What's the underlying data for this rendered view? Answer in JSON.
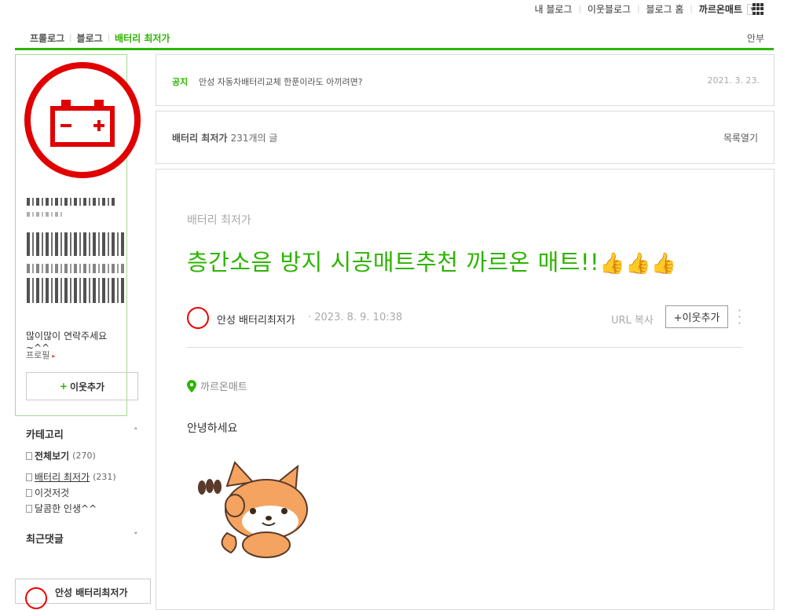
{
  "gnb": {
    "my_blog": "내 블로그",
    "neighbor_blog": "이웃블로그",
    "blog_home": "블로그 홈",
    "user_name": "까르온매트",
    "dropdown_icon": "chevron-down-icon",
    "apps_icon": "grid-icon"
  },
  "menu": {
    "items": [
      {
        "label": "프롤로그"
      },
      {
        "label": "블로그"
      },
      {
        "label": "배터리 최저가"
      }
    ],
    "right": "안부",
    "accent": "#2db400"
  },
  "profile": {
    "intro": "많이많이 연락주세요~^^",
    "profile_link": "프로필",
    "add_neighbor_plus": "+",
    "add_neighbor": "이웃추가",
    "avatar_icon": "battery-icon",
    "avatar_color": "#e00000"
  },
  "category": {
    "title": "카테고리",
    "toggle": "˄",
    "items": [
      {
        "label": "전체보기",
        "count": "(270)"
      },
      {
        "label": "배터리 최저가",
        "count": "(231)"
      },
      {
        "label": "이것저것",
        "count": ""
      },
      {
        "label": "달콤한 인생^^",
        "count": ""
      }
    ]
  },
  "recent": {
    "title": "최근댓글",
    "toggle": "˅"
  },
  "bottom_box": {
    "text": "안성 배터리최저가"
  },
  "notice": {
    "label": "공지",
    "title": "안성 자동차배터리교체 한푼이라도 아끼려면?",
    "date": "2021. 3. 23."
  },
  "category_bar": {
    "name": "배터리 최저가",
    "count": "231개의 글",
    "open_list": "목록열기"
  },
  "post": {
    "category": "배터리 최저가",
    "title": "층간소음 방지 시공매트추천 까르온 매트!!",
    "title_emoji": "👍👍👍",
    "author": "안성 배터리최저가",
    "date": "· 2023. 8. 9. 10:38",
    "url_copy": "URL 복사",
    "add_neighbor": "+이웃추가",
    "more_icon": "more-vertical-icon",
    "place": "까르온매트",
    "place_icon": "map-pin-icon",
    "greeting": "안녕하세요",
    "sticker_icon": "fox-sticker-icon"
  }
}
